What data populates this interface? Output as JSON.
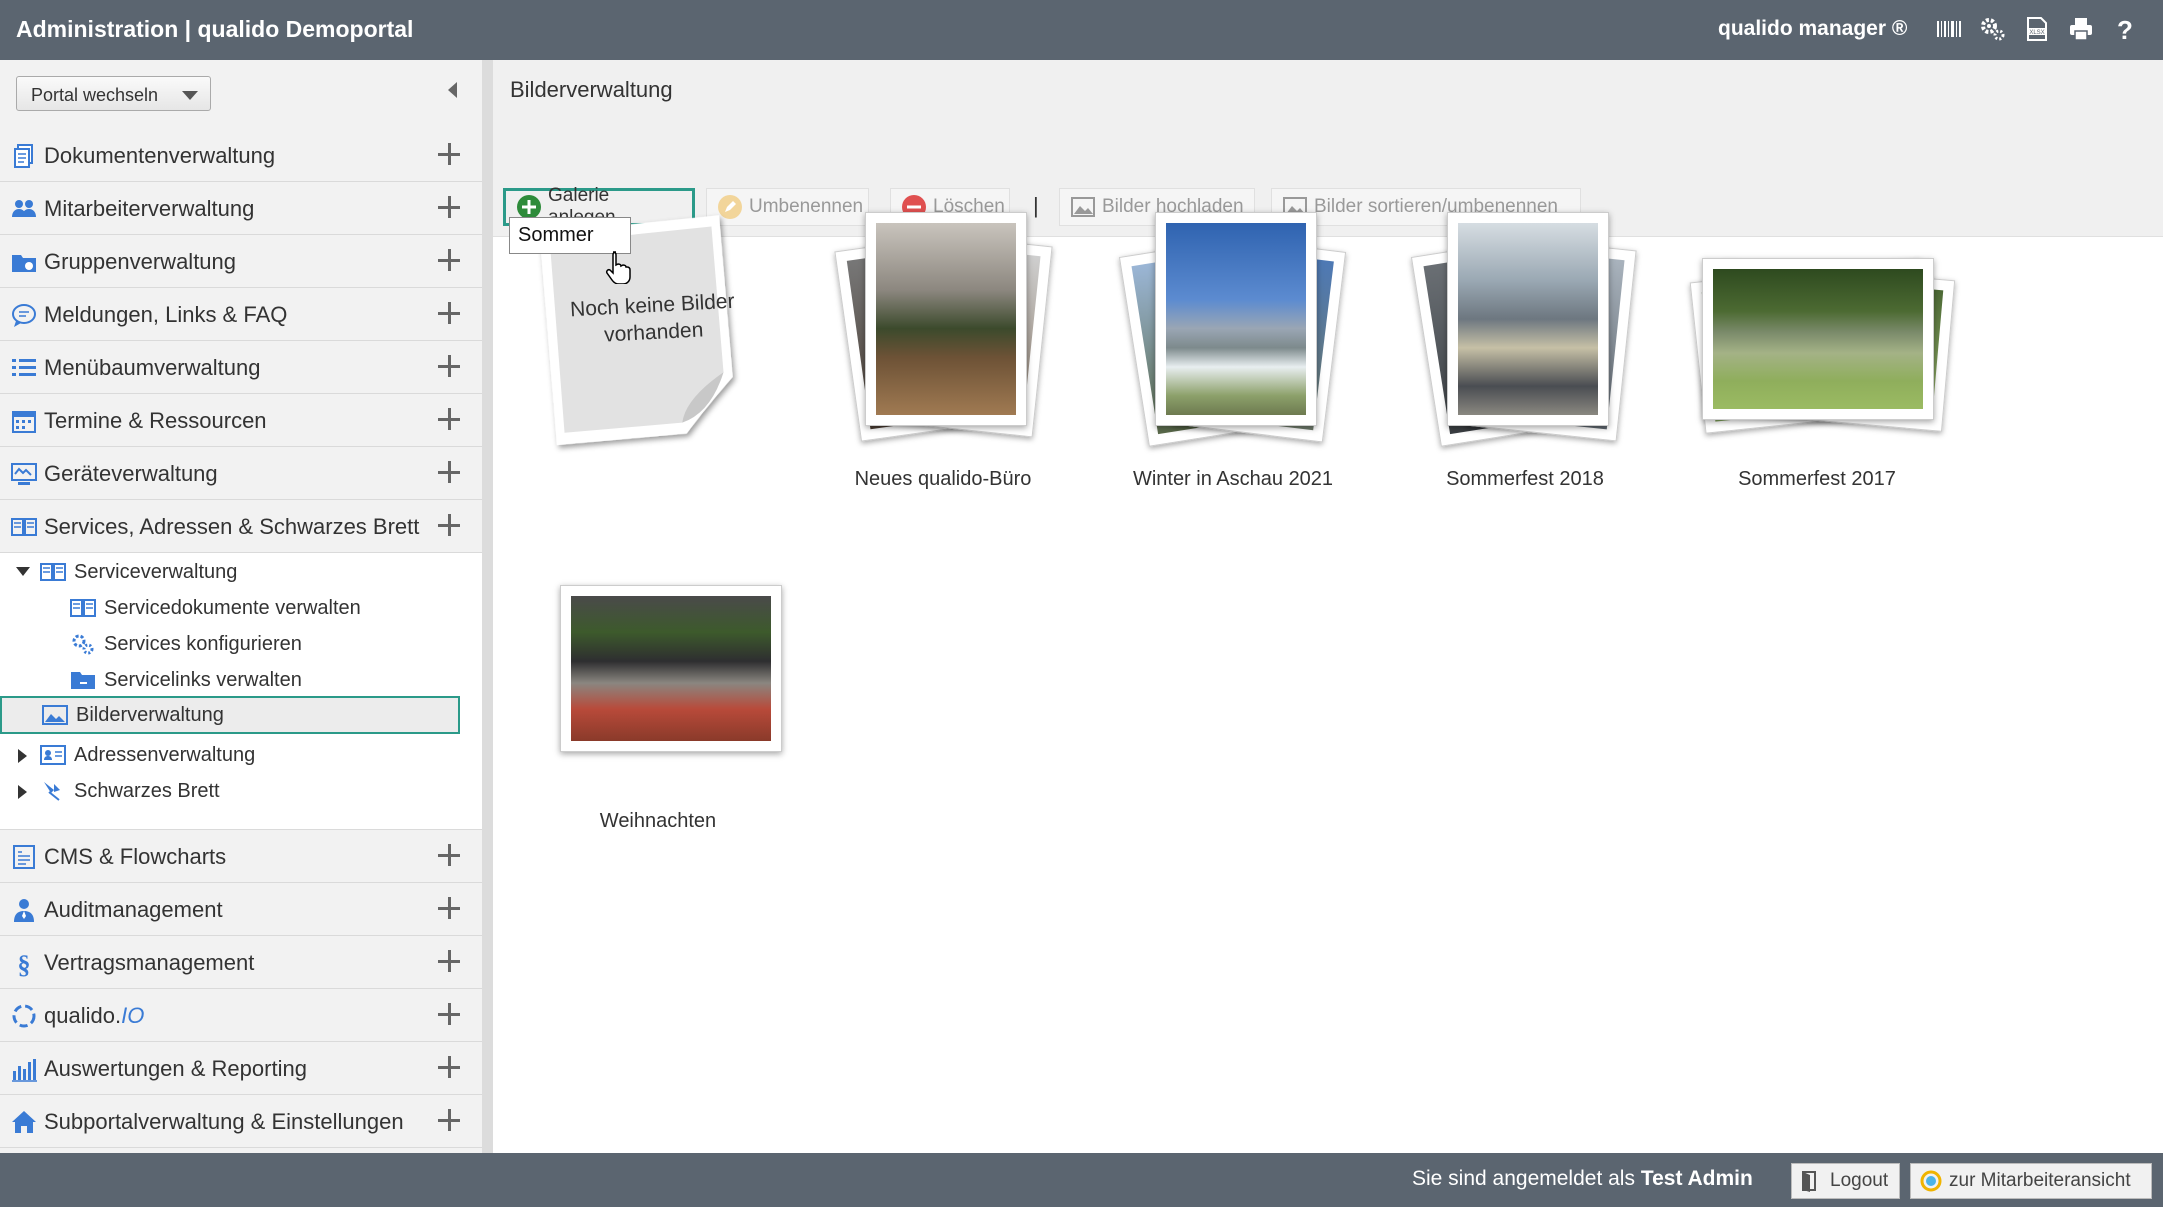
{
  "header": {
    "title": "Administration | qualido Demoportal",
    "brand": "qualido manager ®",
    "icons": [
      "barcode-icon",
      "gears-icon",
      "xlsx-export-icon",
      "print-icon",
      "help-icon"
    ],
    "bg_color": "#5b6570"
  },
  "sidebar": {
    "portal_switch": "Portal wechseln",
    "items_top": [
      {
        "label": "Dokumentenverwaltung",
        "icon": "documents-icon"
      },
      {
        "label": "Mitarbeiterverwaltung",
        "icon": "users-icon"
      },
      {
        "label": "Gruppenverwaltung",
        "icon": "group-folder-icon"
      },
      {
        "label": "Meldungen, Links & FAQ",
        "icon": "chat-icon"
      },
      {
        "label": "Menübaumverwaltung",
        "icon": "list-icon"
      },
      {
        "label": "Termine & Ressourcen",
        "icon": "calendar-icon"
      },
      {
        "label": "Geräteverwaltung",
        "icon": "device-icon"
      },
      {
        "label": "Services, Adressen & Schwarzes Brett",
        "icon": "book-icon"
      }
    ],
    "subtree": {
      "serviceverwaltung": "Serviceverwaltung",
      "servicedokumente": "Servicedokumente verwalten",
      "services_konfigurieren": "Services konfigurieren",
      "servicelinks": "Servicelinks verwalten",
      "bilderverwaltung": "Bilderverwaltung",
      "adressenverwaltung": "Adressenverwaltung",
      "schwarzes_brett": "Schwarzes Brett"
    },
    "items_bottom": [
      {
        "label": "CMS & Flowcharts",
        "icon": "cms-icon"
      },
      {
        "label": "Auditmanagement",
        "icon": "auditor-icon"
      },
      {
        "label": "Vertragsmanagement",
        "icon": "paragraph-icon"
      },
      {
        "label": "qualido.",
        "label_italic": "IO",
        "icon": "qualido-io-icon"
      },
      {
        "label": "Auswertungen & Reporting",
        "icon": "bar-chart-icon"
      },
      {
        "label": "Subportalverwaltung & Einstellungen",
        "icon": "house-icon"
      }
    ]
  },
  "main": {
    "title": "Bilderverwaltung",
    "toolbar": {
      "create": "Galerie anlegen",
      "rename": "Umbenennen",
      "delete": "Löschen",
      "separator": "|",
      "upload": "Bilder hochladen",
      "sort": "Bilder sortieren/umbenennen"
    },
    "rename_value": "Sommer",
    "empty_note": "Noch keine Bilder vorhanden",
    "galleries": [
      {
        "caption": "Neues qualido-Büro"
      },
      {
        "caption": "Winter in Aschau 2021"
      },
      {
        "caption": "Sommerfest 2018"
      },
      {
        "caption": "Sommerfest 2017"
      },
      {
        "caption": "Weihnachten"
      }
    ]
  },
  "footer": {
    "logged_prefix": "Sie sind angemeldet als",
    "user": "Test Admin",
    "logout": "Logout",
    "employee_view": "zur Mitarbeiteransicht"
  },
  "colors": {
    "accent": "#2b9a89",
    "icon_blue": "#3a7bd5",
    "create_green": "#2e8b3a",
    "delete_red": "#e05050"
  }
}
